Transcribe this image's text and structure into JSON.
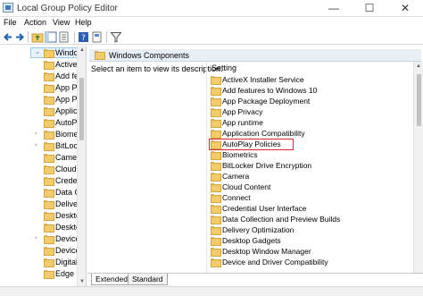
{
  "window": {
    "title": "Local Group Policy Editor",
    "minimize_glyph": "—",
    "maximize_glyph": "☐",
    "close_glyph": "✕"
  },
  "menu": [
    "File",
    "Action",
    "View",
    "Help"
  ],
  "toolbar": {
    "icons": [
      "back-arrow-icon",
      "forward-arrow-icon",
      "folder-up-icon",
      "show-hide-tree-icon",
      "export-list-icon",
      "help-icon",
      "properties-icon",
      "filter-icon"
    ]
  },
  "tree": {
    "selected": "Windows C",
    "items": [
      {
        "label": "Windows C",
        "expander": "⌄"
      },
      {
        "label": "ActiveX",
        "expander": ""
      },
      {
        "label": "Add fe",
        "expander": ""
      },
      {
        "label": "App Pa",
        "expander": ""
      },
      {
        "label": "App Pr",
        "expander": ""
      },
      {
        "label": "Applicat",
        "expander": ""
      },
      {
        "label": "AutoPl",
        "expander": ""
      },
      {
        "label": "Biome",
        "expander": "›"
      },
      {
        "label": "BitLock",
        "expander": "›"
      },
      {
        "label": "Camer",
        "expander": ""
      },
      {
        "label": "Cloud",
        "expander": ""
      },
      {
        "label": "Crede",
        "expander": ""
      },
      {
        "label": "Data C",
        "expander": ""
      },
      {
        "label": "Deliver",
        "expander": ""
      },
      {
        "label": "Deskto",
        "expander": ""
      },
      {
        "label": "Deskto",
        "expander": ""
      },
      {
        "label": "Device",
        "expander": "›"
      },
      {
        "label": "Device",
        "expander": ""
      },
      {
        "label": "Digital",
        "expander": ""
      },
      {
        "label": "Edge U",
        "expander": ""
      }
    ]
  },
  "main": {
    "header": "Windows Components",
    "description": "Select an item to view its description.",
    "column_header": "Setting",
    "selected_setting": "AutoPlay Policies",
    "settings": [
      "ActiveX Installer Service",
      "Add features to Windows 10",
      "App Package Deployment",
      "App Privacy",
      "App runtime",
      "Application Compatibility",
      "AutoPlay Policies",
      "Biometrics",
      "BitLocker Drive Encryption",
      "Camera",
      "Cloud Content",
      "Connect",
      "Credential User Interface",
      "Data Collection and Preview Builds",
      "Delivery Optimization",
      "Desktop Gadgets",
      "Desktop Window Manager",
      "Device and Driver Compatibility"
    ]
  },
  "tabs": [
    {
      "label": "Extended",
      "active": true
    },
    {
      "label": "Standard",
      "active": false
    }
  ],
  "colors": {
    "selection_highlight": "#e2252d",
    "header_bar": "#e7eff7",
    "folder": "#f3cb6a"
  }
}
